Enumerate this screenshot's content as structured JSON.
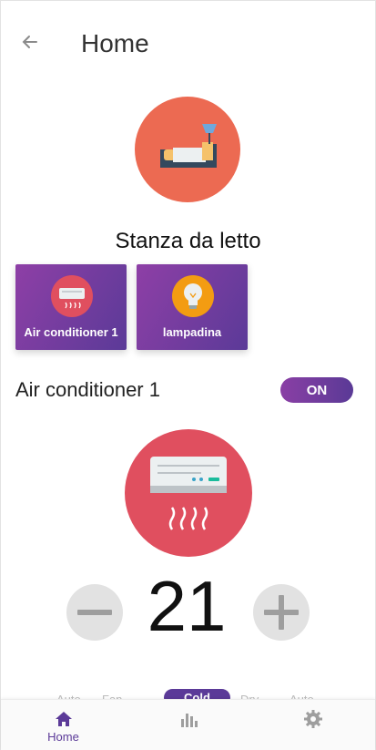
{
  "header": {
    "title": "Home",
    "back_icon": "arrow-left-icon"
  },
  "room": {
    "name": "Stanza da letto",
    "icon": "bedroom-icon"
  },
  "devices": [
    {
      "label": "Air conditioner 1",
      "icon": "air-conditioner-icon"
    },
    {
      "label": "lampadina",
      "icon": "lightbulb-icon"
    }
  ],
  "selected_device": {
    "name": "Air conditioner 1",
    "power_label": "ON"
  },
  "climate": {
    "temperature": "21"
  },
  "modes": [
    "Auto",
    "Fan",
    "Cold",
    "Dry",
    "Auto"
  ],
  "bottom_nav": [
    {
      "label": "Home",
      "icon": "home-icon",
      "active": true
    },
    {
      "label": "",
      "icon": "bar-chart-icon",
      "active": false
    },
    {
      "label": "",
      "icon": "gear-icon",
      "active": false
    }
  ],
  "colors": {
    "accent": "#5b3a98",
    "gradient_start": "#8e3fa6",
    "room_circle": "#ec6a52",
    "ac_circle": "#e04f5f",
    "bulb_circle": "#f39c12"
  }
}
